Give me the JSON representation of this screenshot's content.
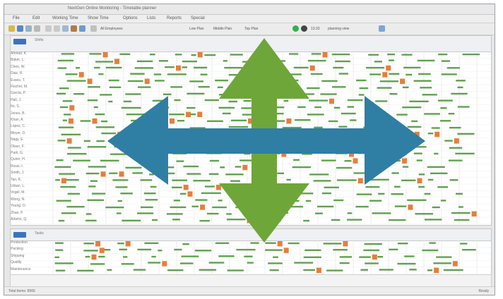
{
  "window": {
    "title": "NextGen Online Monitoring - Timetable planner"
  },
  "menu": {
    "items": [
      "File",
      "Edit",
      "Working Time",
      "Show Time",
      "Options",
      "Lists",
      "Reports",
      "Special"
    ]
  },
  "toolbar": {
    "filter_label": "All Employees",
    "flag1": "Low Plan",
    "flag2": "Middle Plan",
    "flag3": "Top Plan",
    "zoom_label": "13:33",
    "next_label": "planning view"
  },
  "upper_pane": {
    "header_label": "Shifts",
    "rows": [
      "Ahmad, K.",
      "Baker, L.",
      "Chen, W.",
      "Diaz, R.",
      "Evans, T.",
      "Fischer, M.",
      "Garcia, P.",
      "Hall, J.",
      "Ito, S.",
      "Jones, B.",
      "Khan, A.",
      "Lopez, C.",
      "Meyer, D.",
      "Nagy, E.",
      "Olsen, F.",
      "Park, G.",
      "Quinn, H.",
      "Rossi, I.",
      "Smith, J.",
      "Tan, K.",
      "Urban, L.",
      "Vogel, M.",
      "Wong, N.",
      "Young, O.",
      "Zhao, P.",
      "Adams, Q."
    ]
  },
  "lower_pane": {
    "header_label": "Tasks",
    "rows": [
      "Production",
      "Packing",
      "Shipping",
      "Quality",
      "Maintenance"
    ]
  },
  "colors": {
    "arrow_green": "#6ea63a",
    "arrow_blue": "#2f7ea3",
    "bar_green": "#5fa24d",
    "bar_orange": "#e67e3c",
    "bar_red": "#d0352f",
    "bar_blue": "#3b73c0"
  },
  "overlay": {
    "vertical_arrow": "vertical-double-arrow-icon",
    "horizontal_arrow": "horizontal-double-arrow-icon"
  },
  "statusbar": {
    "left_text": "Total items: 8566",
    "right_text": "Ready"
  }
}
